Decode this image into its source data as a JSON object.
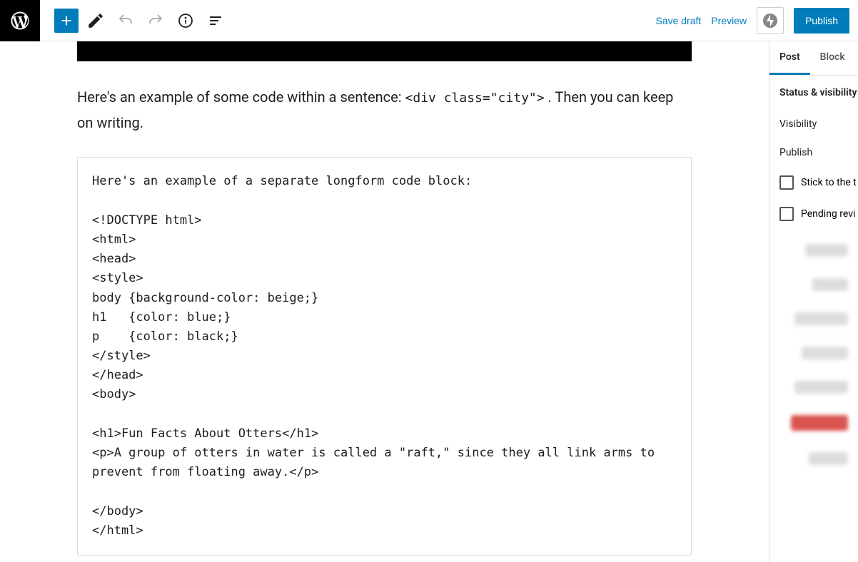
{
  "toolbar": {
    "save_draft": "Save draft",
    "preview": "Preview",
    "publish": "Publish"
  },
  "editor": {
    "paragraph_before": "Here's an example of some code within a sentence: ",
    "inline_code": "<div class=\"city\">",
    "paragraph_after": " . Then you can keep on writing.",
    "code_block": "Here's an example of a separate longform code block:\n\n<!DOCTYPE html>\n<html>\n<head>\n<style>\nbody {background-color: beige;}\nh1   {color: blue;}\np    {color: black;}\n</style>\n</head>\n<body>\n\n<h1>Fun Facts About Otters</h1>\n<p>A group of otters in water is called a \"raft,\" since they all link arms to prevent from floating away.</p>\n\n</body>\n</html>"
  },
  "sidebar": {
    "tabs": {
      "post": "Post",
      "block": "Block"
    },
    "status_heading": "Status & visibility",
    "visibility_label": "Visibility",
    "publish_label": "Publish",
    "sticky_label": "Stick to the t",
    "pending_label": "Pending revi"
  }
}
